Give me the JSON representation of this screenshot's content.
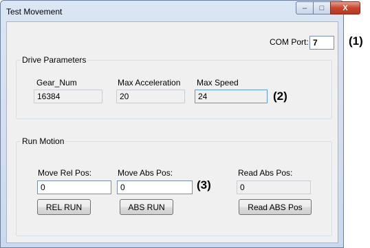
{
  "window": {
    "title": "Test Movement",
    "minimize": "–",
    "maximize": "□",
    "close": "X"
  },
  "com": {
    "label": "COM Port:",
    "value": "7"
  },
  "drive": {
    "group_title": "Drive Parameters",
    "gear": {
      "label": "Gear_Num",
      "value": "16384"
    },
    "accel": {
      "label": "Max Acceleration",
      "value": "20"
    },
    "speed": {
      "label": "Max Speed",
      "value": "24"
    }
  },
  "run": {
    "group_title": "Run Motion",
    "rel": {
      "label": "Move Rel Pos:",
      "value": "0",
      "button": "REL RUN"
    },
    "abs": {
      "label": "Move Abs Pos:",
      "value": "0",
      "button": "ABS RUN"
    },
    "read": {
      "label": "Read Abs Pos:",
      "value": "0",
      "button": "Read ABS Pos"
    }
  },
  "annotations": {
    "a1": "(1)",
    "a2": "(2)",
    "a3": "(3)"
  }
}
